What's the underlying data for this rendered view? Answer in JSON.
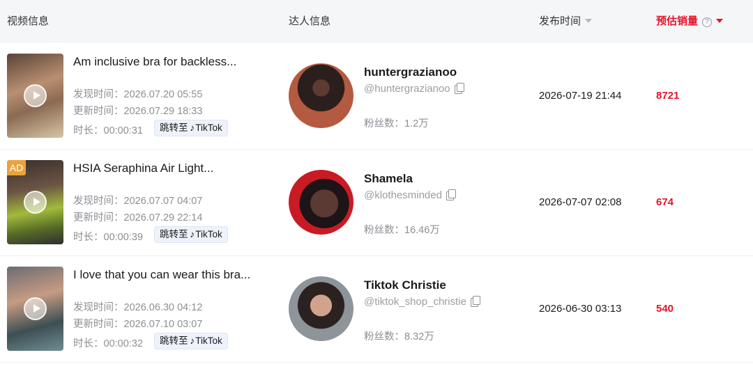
{
  "header": {
    "video_info": "视频信息",
    "creator_info": "达人信息",
    "publish_time": "发布时间",
    "est_sales": "预估销量",
    "help_icon": "?"
  },
  "labels": {
    "discover": "发现时间：",
    "update": "更新时间：",
    "duration": "时长：",
    "jump_to": "跳转至",
    "tiktok": "TikTok",
    "fans": "粉丝数：",
    "ad": "AD"
  },
  "rows": [
    {
      "title": "Am inclusive bra for backless...",
      "discover_time": "2026.07.20 05:55",
      "update_time": "2026.07.29 18:33",
      "duration": "00:00:31",
      "creator_name": "huntergrazianoo",
      "creator_handle": "@huntergrazianoo",
      "fans": "1.2万",
      "publish_time": "2026-07-19 21:44",
      "sales": "8721",
      "is_ad": false
    },
    {
      "title": "HSIA Seraphina Air Light...",
      "discover_time": "2026.07.07 04:07",
      "update_time": "2026.07.29 22:14",
      "duration": "00:00:39",
      "creator_name": "Shamela",
      "creator_handle": "@klothesminded",
      "fans": "16.46万",
      "publish_time": "2026-07-07 02:08",
      "sales": "674",
      "is_ad": true
    },
    {
      "title": "I love that you can wear this bra...",
      "discover_time": "2026.06.30 04:12",
      "update_time": "2026.07.10 03:07",
      "duration": "00:00:32",
      "creator_name": "Tiktok Christie",
      "creator_handle": "@tiktok_shop_christie",
      "fans": "8.32万",
      "publish_time": "2026-06-30 03:13",
      "sales": "540",
      "is_ad": false
    }
  ],
  "colors": {
    "accent_red": "#e8122a",
    "header_bg": "#f5f6f8",
    "muted_text": "#8c8f94",
    "tiktok_button_bg": "#eef2fb",
    "ad_badge": "#e8a33c"
  },
  "icons": {
    "play": "play-icon",
    "copy": "copy-icon",
    "sort_desc": "caret-down-icon",
    "help": "question-circle-icon",
    "tiktok": "tiktok-logo-icon"
  }
}
